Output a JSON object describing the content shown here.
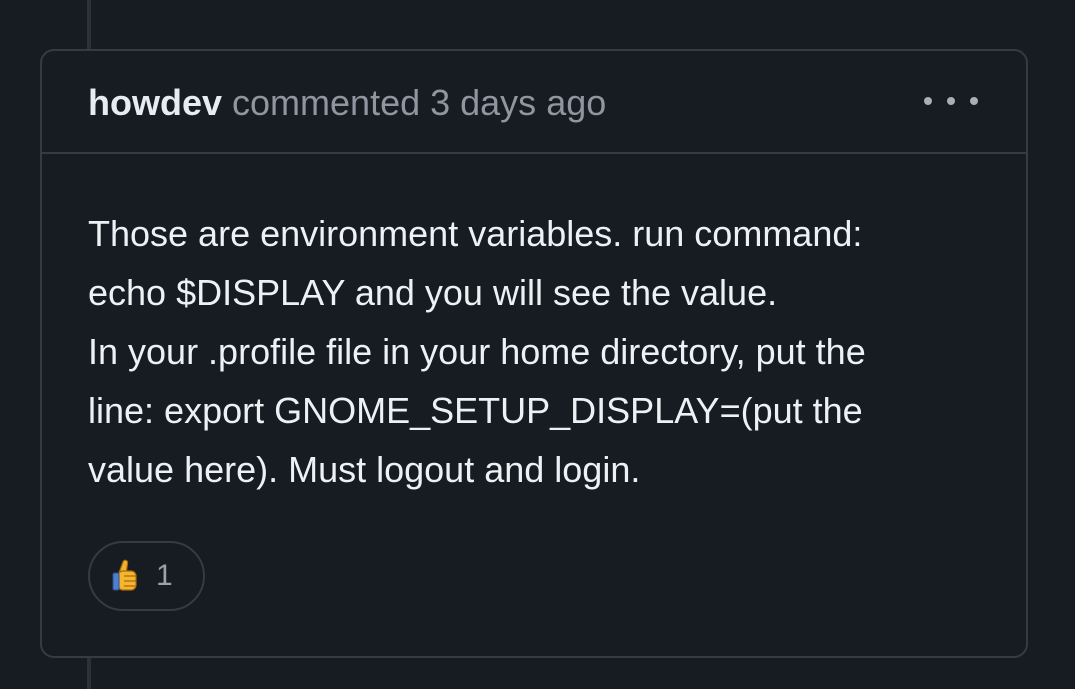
{
  "comment": {
    "author": "howdev",
    "meta": "commented 3 days ago",
    "body_lines": [
      "Those are environment variables. run command:",
      "echo $DISPLAY and you will see the value.",
      "In your .profile file in your home directory, put the",
      "line: export GNOME_SETUP_DISPLAY=(put the",
      "value here). Must logout and login."
    ],
    "reaction": {
      "icon": "thumbs-up-icon",
      "count": "1"
    }
  }
}
